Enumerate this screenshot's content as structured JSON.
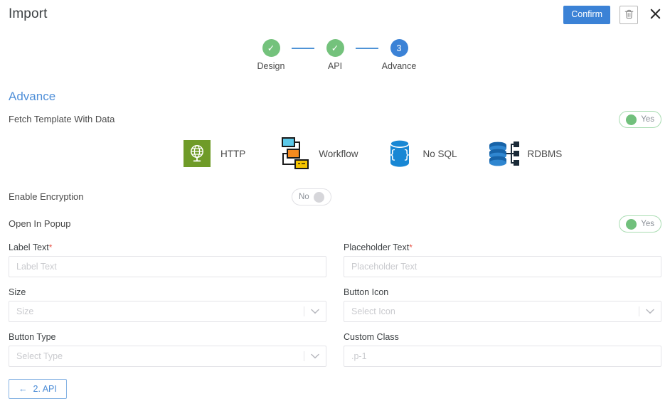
{
  "header": {
    "title": "Import",
    "confirm_label": "Confirm",
    "delete_icon": "trash-icon",
    "close_icon": "close-icon"
  },
  "stepper": {
    "steps": [
      {
        "label": "Design",
        "marker": "✓",
        "state": "done"
      },
      {
        "label": "API",
        "marker": "✓",
        "state": "done"
      },
      {
        "label": "Advance",
        "marker": "3",
        "state": "current"
      }
    ]
  },
  "section": {
    "title": "Advance"
  },
  "toggles": [
    {
      "label": "Fetch Template With Data",
      "value": "Yes",
      "state": "on"
    },
    {
      "label": "Enable Encryption",
      "value": "No",
      "state": "off"
    },
    {
      "label": "Open In Popup",
      "value": "Yes",
      "state": "on"
    }
  ],
  "template_types": [
    {
      "label": "HTTP",
      "icon": "http-globe-icon"
    },
    {
      "label": "Workflow",
      "icon": "workflow-icon"
    },
    {
      "label": "No SQL",
      "icon": "nosql-database-icon"
    },
    {
      "label": "RDBMS",
      "icon": "rdbms-database-icon"
    }
  ],
  "form": {
    "rows": [
      [
        {
          "label": "Label Text",
          "required": true,
          "type": "text",
          "value": "",
          "placeholder": "Label Text"
        },
        {
          "label": "Placeholder Text",
          "required": true,
          "type": "text",
          "value": "",
          "placeholder": "Placeholder Text"
        }
      ],
      [
        {
          "label": "Size",
          "required": false,
          "type": "select",
          "value": "",
          "placeholder": "Size"
        },
        {
          "label": "Button Icon",
          "required": false,
          "type": "select",
          "value": "",
          "placeholder": "Select Icon"
        }
      ],
      [
        {
          "label": "Button Type",
          "required": false,
          "type": "select",
          "value": "",
          "placeholder": "Select Type"
        },
        {
          "label": "Custom Class",
          "required": false,
          "type": "text",
          "value": "",
          "placeholder": ".p-1"
        }
      ]
    ]
  },
  "footer": {
    "back_label": "2. API",
    "back_arrow": "←"
  },
  "colors": {
    "accent_blue": "#3b82d6",
    "section_blue": "#4f8fd8",
    "toggle_green": "#71c07c",
    "step_done_green": "#74c27c",
    "required_red": "#e8564a",
    "http_green": "#6f9b28"
  }
}
